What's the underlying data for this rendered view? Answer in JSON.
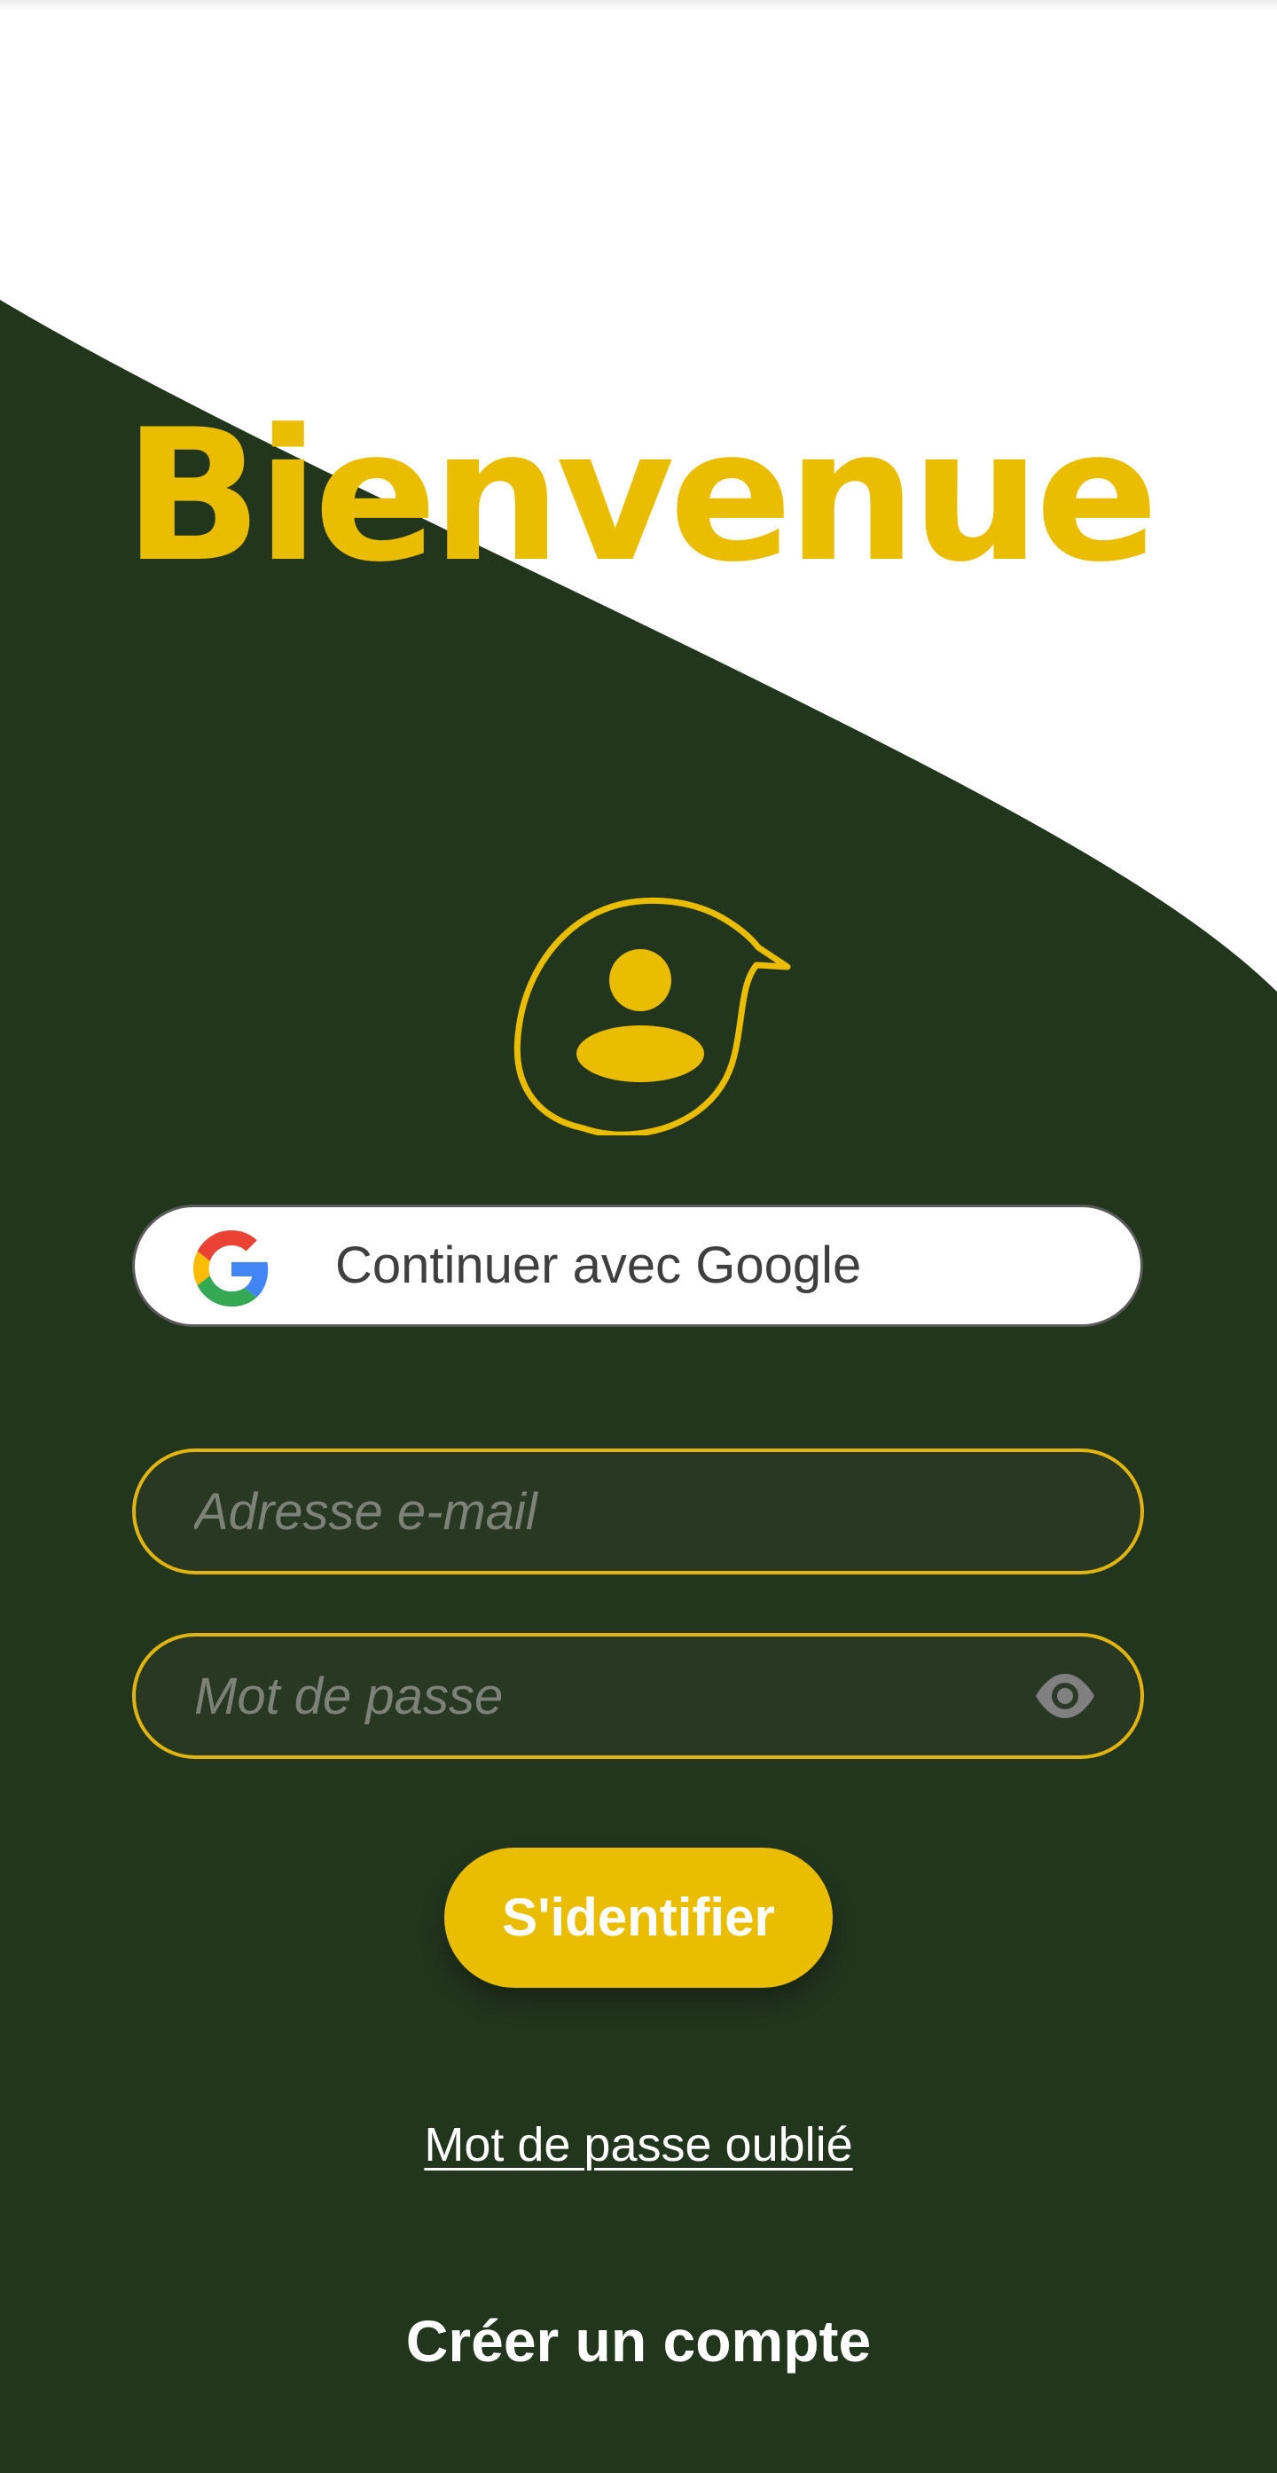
{
  "title": "Bienvenue",
  "google_button": {
    "label": "Continuer avec Google",
    "icon": "google-logo-icon"
  },
  "email_field": {
    "placeholder": "Adresse e-mail",
    "value": ""
  },
  "password_field": {
    "placeholder": "Mot de passe",
    "value": "",
    "icon": "eye-icon"
  },
  "login_button": {
    "label": "S'identifier"
  },
  "forgot_password": {
    "label": "Mot de passe oublié"
  },
  "create_account": {
    "label": "Créer un compte"
  },
  "colors": {
    "dark_green": "#22361e",
    "accent_yellow": "#ebbd00",
    "field_border": "#e1b40f",
    "white": "#ffffff"
  },
  "logo": {
    "icon": "user-speech-bubble-icon"
  }
}
